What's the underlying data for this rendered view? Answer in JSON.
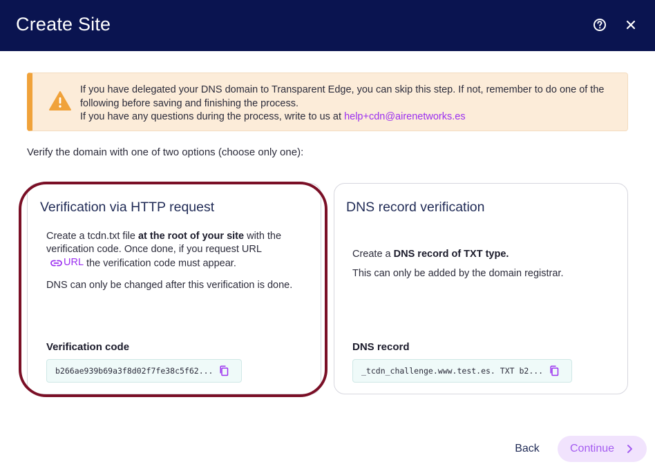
{
  "header": {
    "title": "Create Site",
    "help_icon": "help-circle-icon",
    "close_icon": "close-icon"
  },
  "alert": {
    "icon": "warning-icon",
    "line1": "If you have delegated your DNS domain to Transparent Edge, you can skip this step. If not, remember to do one of the following before saving and finishing the process.",
    "line2": "If you have any questions during the process, write to us at ",
    "email": "help+cdn@airenetworks.es",
    "accent_color": "#f0a23a",
    "background_color": "#fcecd9"
  },
  "intro": "Verify the domain with one of two options (choose only one):",
  "http_card": {
    "title": "Verification via HTTP request",
    "text_a": "Create a tcdn.txt file ",
    "text_bold": "at the root of your site",
    "text_b": " with the verification code. Once done, if you request URL",
    "url_icon": "link-icon",
    "url_label": "URL",
    "text_c": " the verification code must appear.",
    "note": "DNS can only be changed after this verification is done.",
    "code_label": "Verification code",
    "code_value": "b266ae939b69a3f8d02f7fe38c5f62...",
    "copy_icon": "copy-icon"
  },
  "dns_card": {
    "title": "DNS record verification",
    "text_a": "Create a ",
    "text_bold": "DNS record of TXT type.",
    "note": "This can only be added by the domain registrar.",
    "code_label": "DNS record",
    "code_value": "_tcdn_challenge.www.test.es. TXT b2...",
    "copy_icon": "copy-icon"
  },
  "footer": {
    "back_label": "Back",
    "continue_label": "Continue",
    "continue_icon": "chevron-right-icon"
  },
  "colors": {
    "header_bg": "#0a1450",
    "link": "#9b2ff0",
    "highlight_ring": "#7a0f26"
  }
}
